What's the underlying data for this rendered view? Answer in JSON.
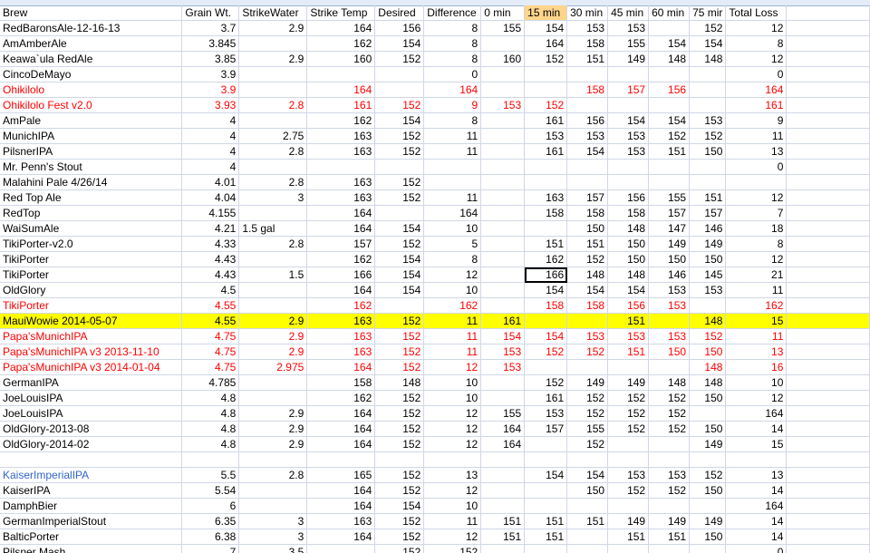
{
  "headers": [
    "Brew",
    "Grain Wt.",
    "StrikeWater",
    "Strike Temp",
    "Desired",
    "Difference",
    "0 min",
    "15 min",
    "30 min",
    "45 min",
    "60 min",
    "75 mir",
    "Total Loss",
    ""
  ],
  "rows": [
    {
      "style": "",
      "cells": [
        "RedBaronsAle-12-16-13",
        "3.7",
        "2.9",
        "164",
        "156",
        "8",
        "155",
        "154",
        "153",
        "153",
        "",
        "152",
        "12",
        ""
      ]
    },
    {
      "style": "",
      "cells": [
        "AmAmberAle",
        "3.845",
        "",
        "162",
        "154",
        "8",
        "",
        "164",
        "158",
        "155",
        "154",
        "154",
        "8",
        ""
      ]
    },
    {
      "style": "",
      "cells": [
        "Keawa`ula RedAle",
        "3.85",
        "2.9",
        "160",
        "152",
        "8",
        "160",
        "152",
        "151",
        "149",
        "148",
        "148",
        "12",
        ""
      ]
    },
    {
      "style": "",
      "cells": [
        "CincoDeMayo",
        "3.9",
        "",
        "",
        "",
        "0",
        "",
        "",
        "",
        "",
        "",
        "",
        "0",
        ""
      ]
    },
    {
      "style": "red",
      "cells": [
        "Ohikilolo",
        "3.9",
        "",
        "164",
        "",
        "164",
        "",
        "",
        "158",
        "157",
        "156",
        "",
        "164",
        ""
      ]
    },
    {
      "style": "red",
      "cells": [
        "Ohikilolo Fest v2.0",
        "3.93",
        "2.8",
        "161",
        "152",
        "9",
        "153",
        "152",
        "",
        "",
        "",
        "",
        "161",
        ""
      ]
    },
    {
      "style": "",
      "cells": [
        "AmPale",
        "4",
        "",
        "162",
        "154",
        "8",
        "",
        "161",
        "156",
        "154",
        "154",
        "153",
        "9",
        ""
      ]
    },
    {
      "style": "",
      "cells": [
        "MunichIPA",
        "4",
        "2.75",
        "163",
        "152",
        "11",
        "",
        "153",
        "153",
        "153",
        "152",
        "152",
        "11",
        ""
      ]
    },
    {
      "style": "",
      "cells": [
        "PilsnerIPA",
        "4",
        "2.8",
        "163",
        "152",
        "11",
        "",
        "161",
        "154",
        "153",
        "151",
        "150",
        "13",
        ""
      ]
    },
    {
      "style": "",
      "cells": [
        "Mr. Penn's Stout",
        "4",
        "",
        "",
        "",
        "",
        "",
        "",
        "",
        "",
        "",
        "",
        "0",
        ""
      ]
    },
    {
      "style": "",
      "cells": [
        "Malahini Pale 4/26/14",
        "4.01",
        "2.8",
        "163",
        "152",
        "",
        "",
        "",
        "",
        "",
        "",
        "",
        "",
        ""
      ]
    },
    {
      "style": "",
      "cells": [
        "Red Top Ale",
        "4.04",
        "3",
        "163",
        "152",
        "11",
        "",
        "163",
        "157",
        "156",
        "155",
        "151",
        "12",
        ""
      ]
    },
    {
      "style": "",
      "cells": [
        "RedTop",
        "4.155",
        "",
        "164",
        "",
        "164",
        "",
        "158",
        "158",
        "158",
        "157",
        "157",
        "7",
        ""
      ]
    },
    {
      "style": "",
      "cells": [
        "WaiSumAle",
        "4.21",
        "1.5 gal",
        "164",
        "154",
        "10",
        "",
        "",
        "150",
        "148",
        "147",
        "146",
        "18",
        ""
      ]
    },
    {
      "style": "",
      "cells": [
        "TikiPorter-v2.0",
        "4.33",
        "2.8",
        "157",
        "152",
        "5",
        "",
        "151",
        "151",
        "150",
        "149",
        "149",
        "8",
        ""
      ]
    },
    {
      "style": "",
      "cells": [
        "TikiPorter",
        "4.43",
        "",
        "162",
        "154",
        "8",
        "",
        "162",
        "152",
        "150",
        "150",
        "150",
        "12",
        ""
      ]
    },
    {
      "style": "",
      "cells": [
        "TikiPorter",
        "4.43",
        "1.5",
        "166",
        "154",
        "12",
        "",
        "166",
        "148",
        "148",
        "146",
        "145",
        "21",
        ""
      ]
    },
    {
      "style": "",
      "cells": [
        "OldGlory",
        "4.5",
        "",
        "164",
        "154",
        "10",
        "",
        "154",
        "154",
        "154",
        "153",
        "153",
        "11",
        ""
      ]
    },
    {
      "style": "red",
      "cells": [
        "TikiPorter",
        "4.55",
        "",
        "162",
        "",
        "162",
        "",
        "158",
        "158",
        "156",
        "153",
        "",
        "162",
        ""
      ]
    },
    {
      "style": "hl",
      "cells": [
        "MauiWowie 2014-05-07",
        "4.55",
        "2.9",
        "163",
        "152",
        "11",
        "161",
        "",
        "",
        "151",
        "",
        "148",
        "15",
        ""
      ]
    },
    {
      "style": "red",
      "cells": [
        "Papa'sMunichIPA",
        "4.75",
        "2.9",
        "163",
        "152",
        "11",
        "154",
        "154",
        "153",
        "153",
        "153",
        "152",
        "11",
        ""
      ]
    },
    {
      "style": "red",
      "cells": [
        "Papa'sMunichIPA v3 2013-11-10",
        "4.75",
        "2.9",
        "163",
        "152",
        "11",
        "153",
        "152",
        "152",
        "151",
        "150",
        "150",
        "13",
        ""
      ]
    },
    {
      "style": "red",
      "cells": [
        "Papa'sMunichIPA v3 2014-01-04",
        "4.75",
        "2.975",
        "164",
        "152",
        "12",
        "153",
        "",
        "",
        "",
        "",
        "148",
        "16",
        ""
      ]
    },
    {
      "style": "",
      "cells": [
        "GermanIPA",
        "4.785",
        "",
        "158",
        "148",
        "10",
        "",
        "152",
        "149",
        "149",
        "148",
        "148",
        "10",
        ""
      ]
    },
    {
      "style": "",
      "cells": [
        "JoeLouisIPA",
        "4.8",
        "",
        "162",
        "152",
        "10",
        "",
        "161",
        "152",
        "152",
        "152",
        "150",
        "12",
        ""
      ]
    },
    {
      "style": "",
      "cells": [
        "JoeLouisIPA",
        "4.8",
        "2.9",
        "164",
        "152",
        "12",
        "155",
        "153",
        "152",
        "152",
        "152",
        "",
        "164",
        ""
      ]
    },
    {
      "style": "",
      "cells": [
        "OldGlory-2013-08",
        "4.8",
        "2.9",
        "164",
        "152",
        "12",
        "164",
        "157",
        "155",
        "152",
        "152",
        "150",
        "14",
        ""
      ]
    },
    {
      "style": "",
      "cells": [
        "OldGlory-2014-02",
        "4.8",
        "2.9",
        "164",
        "152",
        "12",
        "164",
        "",
        "152",
        "",
        "",
        "149",
        "15",
        ""
      ]
    },
    {
      "style": "",
      "cells": [
        "",
        "",
        "",
        "",
        "",
        "",
        "",
        "",
        "",
        "",
        "",
        "",
        "",
        ""
      ]
    },
    {
      "style": "blue",
      "cells": [
        "KaiserImperialIPA",
        "5.5",
        "2.8",
        "165",
        "152",
        "13",
        "",
        "154",
        "154",
        "153",
        "153",
        "152",
        "13",
        ""
      ]
    },
    {
      "style": "",
      "cells": [
        "KaiserIPA",
        "5.54",
        "",
        "164",
        "152",
        "12",
        "",
        "",
        "150",
        "152",
        "152",
        "150",
        "14",
        ""
      ]
    },
    {
      "style": "",
      "cells": [
        "DamphBier",
        "6",
        "",
        "164",
        "154",
        "10",
        "",
        "",
        "",
        "",
        "",
        "",
        "164",
        ""
      ]
    },
    {
      "style": "",
      "cells": [
        "GermanImperialStout",
        "6.35",
        "3",
        "163",
        "152",
        "11",
        "151",
        "151",
        "151",
        "149",
        "149",
        "149",
        "14",
        ""
      ]
    },
    {
      "style": "",
      "cells": [
        "BalticPorter",
        "6.38",
        "3",
        "164",
        "152",
        "12",
        "151",
        "151",
        "",
        "151",
        "151",
        "150",
        "14",
        ""
      ]
    },
    {
      "style": "",
      "cells": [
        "Pilsner Mash",
        "7",
        "3.5",
        "",
        "152",
        "152",
        "",
        "",
        "",
        "",
        "",
        "",
        "0",
        ""
      ]
    }
  ],
  "selected_cell": {
    "row": 16,
    "col": 7
  },
  "colors": {
    "red_text": "#ff0000",
    "highlight": "#ffff00",
    "blue_text": "#3366cc",
    "gridline": "#d0d7e5"
  }
}
